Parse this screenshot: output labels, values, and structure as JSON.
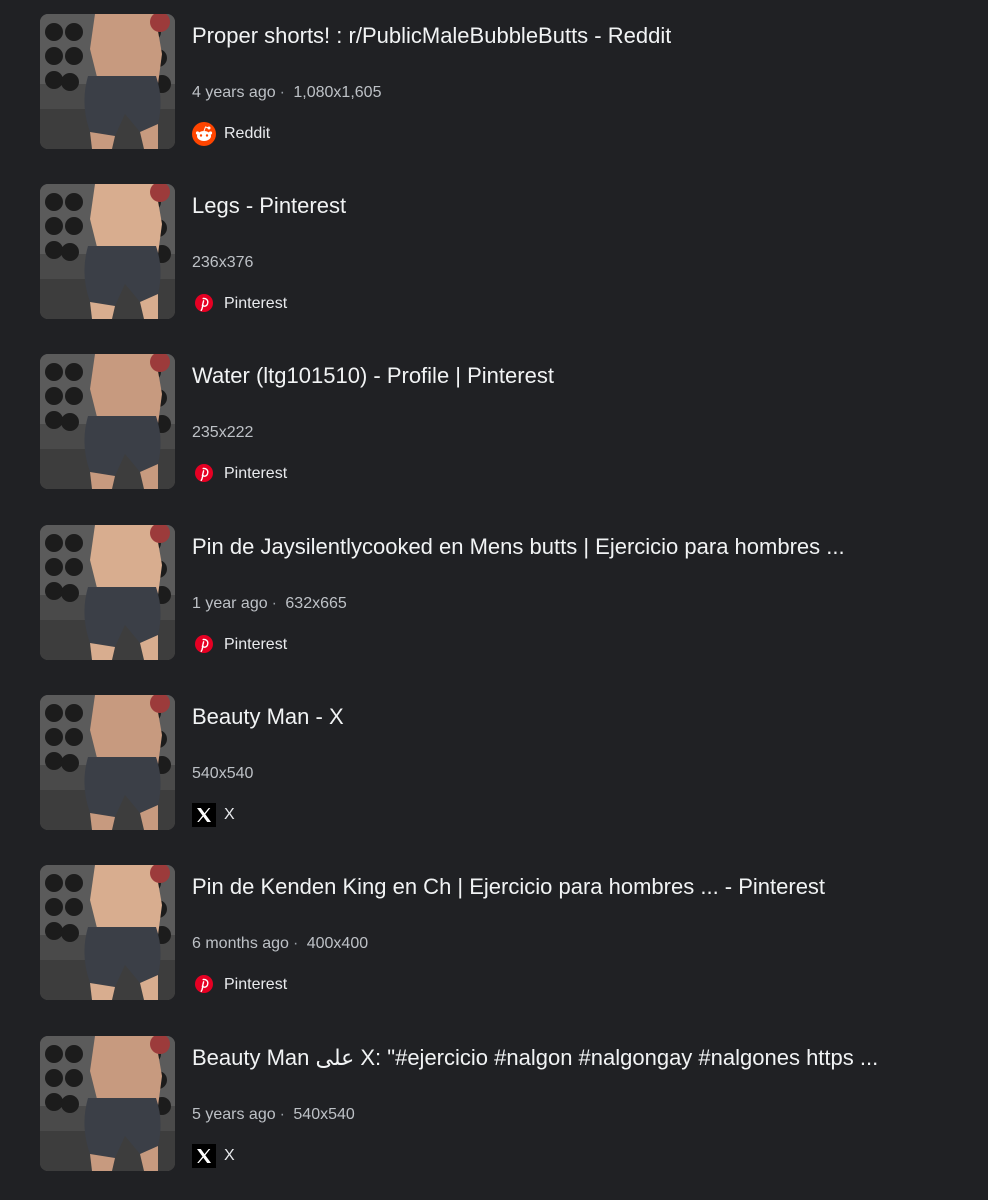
{
  "results": [
    {
      "title": "Proper shorts! : r/PublicMaleBubbleButts - Reddit",
      "age": "4 years ago",
      "dimensions": "1,080x1,605",
      "source": "Reddit",
      "source_icon": "reddit-icon"
    },
    {
      "title": "Legs - Pinterest",
      "age": "",
      "dimensions": "236x376",
      "source": "Pinterest",
      "source_icon": "pinterest-icon"
    },
    {
      "title": "Water (ltg101510) - Profile | Pinterest",
      "age": "",
      "dimensions": "235x222",
      "source": "Pinterest",
      "source_icon": "pinterest-icon"
    },
    {
      "title": "Pin de Jaysilentlycooked en Mens butts | Ejercicio para hombres ...",
      "age": "1 year ago",
      "dimensions": "632x665",
      "source": "Pinterest",
      "source_icon": "pinterest-icon"
    },
    {
      "title": "Beauty Man - X",
      "age": "",
      "dimensions": "540x540",
      "source": "X",
      "source_icon": "x-icon"
    },
    {
      "title": "Pin de Kenden King en Ch | Ejercicio para hombres ... - Pinterest",
      "age": "6 months ago",
      "dimensions": "400x400",
      "source": "Pinterest",
      "source_icon": "pinterest-icon"
    },
    {
      "title": "Beauty Man على X: \"#ejercicio #nalgon #nalgongay #nalgones https ...",
      "age": "5 years ago",
      "dimensions": "540x540",
      "source": "X",
      "source_icon": "x-icon"
    }
  ],
  "meta_separator": "·",
  "colors": {
    "background": "#202124",
    "title": "#f1f3f4",
    "meta": "#bdc1c6",
    "reddit": "#ff4500",
    "pinterest": "#e60023",
    "x": "#000000"
  }
}
